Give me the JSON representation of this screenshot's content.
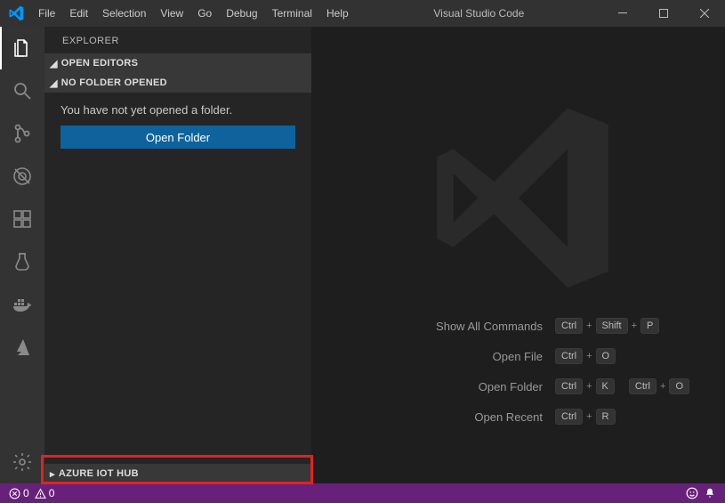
{
  "titlebar": {
    "menus": [
      "File",
      "Edit",
      "Selection",
      "View",
      "Go",
      "Debug",
      "Terminal",
      "Help"
    ],
    "title": "Visual Studio Code"
  },
  "sidebar": {
    "title": "EXPLORER",
    "openEditors": "OPEN EDITORS",
    "noFolderSection": "NO FOLDER OPENED",
    "noFolderMsg": "You have not yet opened a folder.",
    "openFolderBtn": "Open Folder",
    "azureSection": "AZURE IOT HUB"
  },
  "editor": {
    "shortcuts": [
      {
        "label": "Show All Commands",
        "keys": [
          "Ctrl",
          "Shift",
          "P"
        ]
      },
      {
        "label": "Open File",
        "keys": [
          "Ctrl",
          "O"
        ]
      },
      {
        "label": "Open Folder",
        "keys2": [
          [
            "Ctrl",
            "K"
          ],
          [
            "Ctrl",
            "O"
          ]
        ]
      },
      {
        "label": "Open Recent",
        "keys": [
          "Ctrl",
          "R"
        ]
      }
    ]
  },
  "statusbar": {
    "errors": "0",
    "warnings": "0"
  }
}
